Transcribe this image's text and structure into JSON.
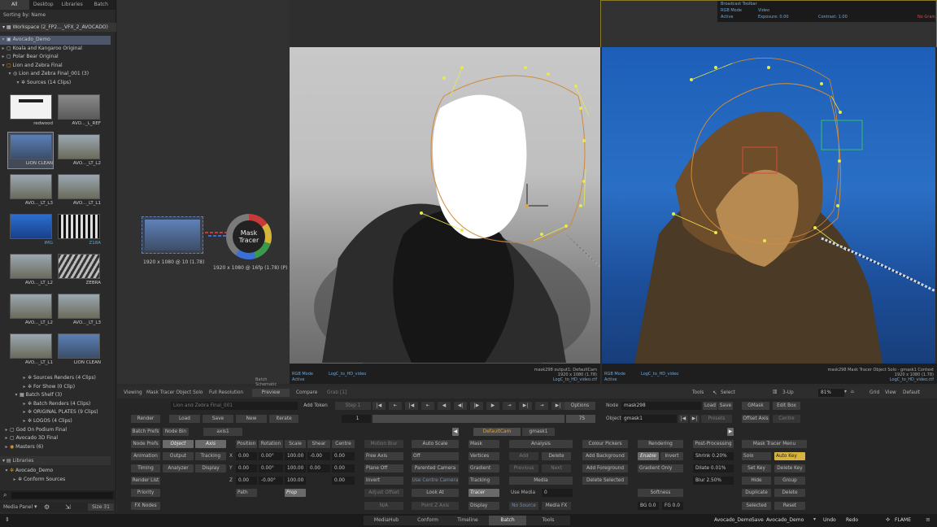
{
  "left": {
    "tabs": [
      "All",
      "Desktop",
      "Libraries",
      "Batch"
    ],
    "sorting": "Sorting by: Name",
    "workspace": "Workspace (2_FP2..._VFX_2_AVOCADO)",
    "tree_top": [
      "Avocado_Demo",
      "Koala and Kangaroo Original",
      "Polar Bear Original",
      "Lion and Zebra Final",
      "Lion and Zebra Final_001 (3)",
      "Sources (14 Clips)"
    ],
    "thumbs": [
      [
        "",
        "redwood"
      ],
      [
        "",
        "AVO..._L_REF"
      ],
      [
        "",
        "LION CLEAN"
      ],
      [
        "",
        "AVO..._LT_L2"
      ],
      [
        "",
        "AVO..._LT_L3"
      ],
      [
        "",
        "AVO..._LT_L1"
      ],
      [
        "",
        "IMG"
      ],
      [
        "",
        "Z18A"
      ],
      [
        "",
        "AVO..._LT_L2"
      ],
      [
        "",
        "ZEBRA"
      ],
      [
        "",
        "AVO..._LT_L2"
      ],
      [
        "",
        "AVO..._LT_L3"
      ],
      [
        "",
        "AVO..._LT_L1"
      ],
      [
        "",
        "LION CLEAN"
      ]
    ],
    "tree_bottom": [
      "Sources Renders (4 Clips)",
      "For Show (0 Clip)",
      "Batch Shelf (3)",
      "Batch Renders (4 Clips)",
      "ORIGINAL PLATES (9 Clips)",
      "LOGOS (4 Clips)",
      "God On Podium Final",
      "Avocado 3D Final",
      "Masters (6)"
    ],
    "libraries": "Libraries",
    "lib_items": [
      "Avocado_Demo",
      "Conform Sources"
    ],
    "media_panel": "Media Panel",
    "size": "Size 31"
  },
  "schematic": {
    "node1_label": "1920 x 1080 @ 10 (1.78)",
    "node2_title": "Mask Tracer",
    "node2_label": "1920 x 1080 @ 16fp (1.78) (P)",
    "batch_schematic": "Batch Schematic"
  },
  "viewer_left": {
    "mode": "RGB Mode",
    "active": "Active",
    "lut": "LogC_to_HD_video",
    "info": [
      "mask298 output1: DefaultCam",
      "1920 x 1080 (1.78)",
      "LogC_to_HD_video.ctf"
    ]
  },
  "viewer_right": {
    "mode": "RGB Mode",
    "active": "Active",
    "lut": "LogC_to_HD_video",
    "info": [
      "mask298 Mask Tracer Object Solo - gmask1 Context",
      "1920 x 1080 (1.78)",
      "LogC_to_HD_video.ctf"
    ],
    "broadcast": {
      "title": "Broadcast Toolbar",
      "rgb": "RGB Mode",
      "video": "Video",
      "active": "Active",
      "exposure": "Exposure: 0.00",
      "contrast": "Contrast: 1.00",
      "no_grain": "No Grain"
    }
  },
  "toolbar": {
    "viewing": "Viewing",
    "view_name": "Mask Tracer Object Solo",
    "full_res": "Full Resolution",
    "preview": "Preview",
    "compare": "Compare",
    "grab": "Grab [1]",
    "tools": "Tools",
    "select": "Select",
    "up": "3-Up",
    "zoom": "81%",
    "grid": "Grid",
    "view": "View",
    "default": "Default"
  },
  "controls": {
    "clip_name": "Lion and Zebra Final_001",
    "add_token": "Add Token",
    "step": "Step 1",
    "frame": "1",
    "end": "75",
    "options": "Options",
    "render": "Render",
    "load": "Load",
    "save": "Save",
    "new": "New",
    "iterate": "Iterate",
    "node_label": "Node",
    "node_value": "mask298",
    "load2": "Load",
    "save2": "Save",
    "object_label": "Object",
    "object_value": "gmask1",
    "presets": "Presets",
    "batch_prefs": "Batch Prefs",
    "node_bin": "Node Bin",
    "axis1": "axis1",
    "default_cam": "DefaultCam",
    "gmask1": "gmask1",
    "col1": [
      "Node Prefs",
      "Animation",
      "Timing",
      "Render List",
      "Priority",
      "FX Nodes"
    ],
    "col2": [
      "Object",
      "Output",
      "Analyzer"
    ],
    "col3": [
      "Axis",
      "Tracking",
      "Display"
    ],
    "axis_headers": [
      "Position",
      "Rotation",
      "Scale",
      "Shear",
      "Centre"
    ],
    "xyz": [
      "X",
      "Y",
      "Z"
    ],
    "x_vals": [
      "0.00",
      "0.00°",
      "100.00",
      "-0.00",
      "0.00"
    ],
    "y_vals": [
      "0.00",
      "0.00°",
      "100.00",
      "0.00",
      "0.00"
    ],
    "z_vals": [
      "0.00",
      "-0.00°",
      "100.00",
      "",
      "0.00"
    ],
    "path": "Path",
    "prop": "Prop",
    "motion_blur": "Motion Blur",
    "free_axis": "Free Axis",
    "plane_off": "Plane Off",
    "invert": "Invert",
    "adjust_offset": "Adjust Offset",
    "na": "N/A",
    "auto_scale": "Auto Scale",
    "off": "Off",
    "parented_camera": "Parented Camera",
    "use_centre_camera": "Use Centre Camera",
    "look_at": "Look At",
    "point_z_axis": "Point Z Axis",
    "mask": "Mask",
    "vertices": "Vertices",
    "gradient": "Gradient",
    "tracking": "Tracking",
    "tracer": "Tracer",
    "display": "Display",
    "analysis": "Analysis",
    "add": "Add",
    "delete": "Delete",
    "previous": "Previous",
    "next": "Next",
    "media": "Media",
    "use_media": "Use Media",
    "media_val": "0",
    "no_source": "No Source",
    "media_fx": "Media FX",
    "colour_pickers": "Colour Pickers",
    "add_background": "Add Background",
    "add_foreground": "Add Foreground",
    "delete_selected": "Delete Selected",
    "rendering": "Rendering",
    "enable": "Enable",
    "invert2": "Invert",
    "gradient_only": "Gradient Only",
    "softness": "Softness",
    "bg": "BG 0.0",
    "fg": "FG 0.0",
    "post_processing": "Post-Processing",
    "shrink": "Shrink 0.20%",
    "dilate": "Dilate 0.01%",
    "blur": "Blur 2.50%",
    "mask_tracer_menu": "Mask Tracer Menu",
    "solo": "Solo",
    "auto_key": "Auto Key",
    "set_key": "Set Key",
    "delete_key": "Delete Key",
    "hide": "Hide",
    "group": "Group",
    "duplicate": "Duplicate",
    "delete2": "Delete",
    "selected": "Selected",
    "reset": "Reset",
    "gmask": "GMask",
    "edit_box": "Edit Box",
    "offset_axis": "Offset Axis",
    "centre": "Centre"
  },
  "bottom": {
    "tabs": [
      "MediaHub",
      "Conform",
      "Timeline",
      "Batch",
      "Tools"
    ],
    "project": "Avocado_Demo",
    "save": "Save",
    "workspace": "Avocado_Demo",
    "undo": "Undo",
    "redo": "Redo",
    "app": "FLAME"
  }
}
